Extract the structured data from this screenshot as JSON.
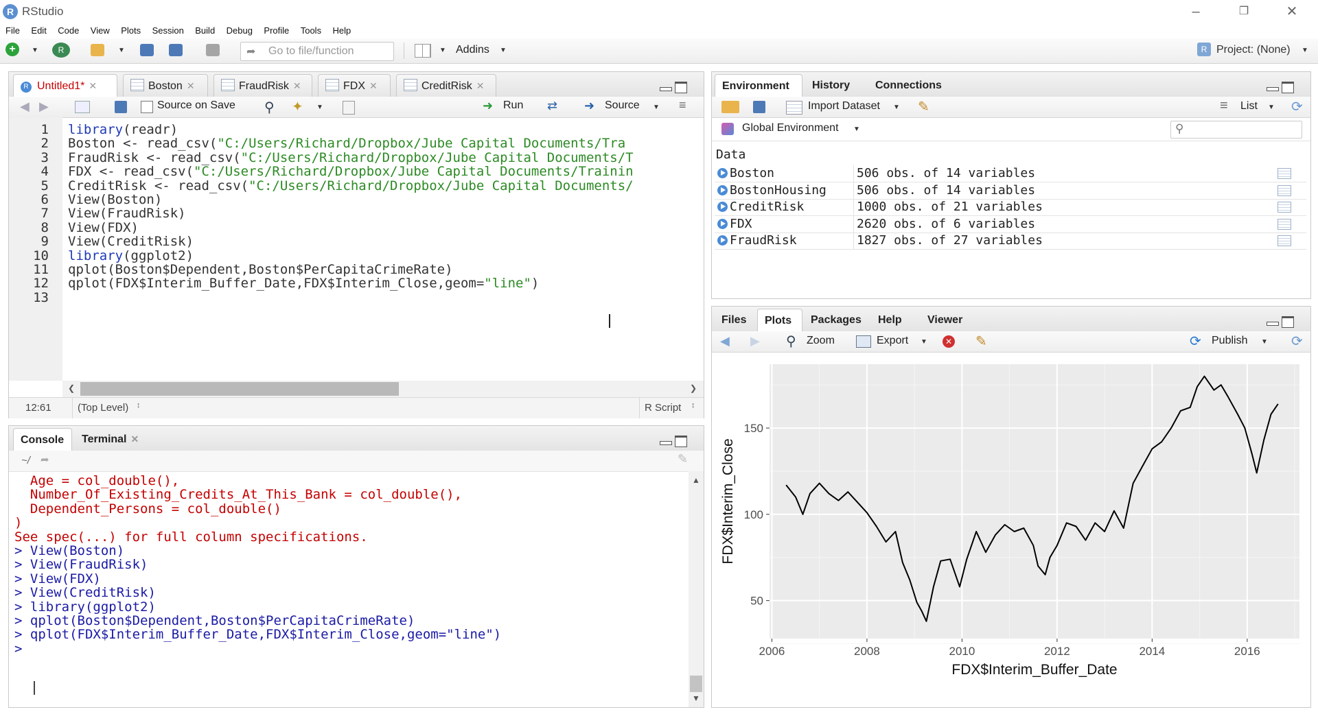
{
  "window": {
    "title": "RStudio",
    "logo": "R"
  },
  "menu": [
    "File",
    "Edit",
    "Code",
    "View",
    "Plots",
    "Session",
    "Build",
    "Debug",
    "Profile",
    "Tools",
    "Help"
  ],
  "toolbar": {
    "goto_placeholder": "Go to file/function",
    "addins": "Addins",
    "project": "Project: (None)"
  },
  "editor": {
    "tabs": [
      "Untitled1*",
      "Boston",
      "FraudRisk",
      "FDX",
      "CreditRisk"
    ],
    "source_on_save": "Source on Save",
    "run": "Run",
    "source": "Source",
    "lines": [
      [
        [
          "kw",
          "library"
        ],
        [
          "op",
          "(readr)"
        ]
      ],
      [
        [
          "op",
          "Boston <- read_csv("
        ],
        [
          "str",
          "\"C:/Users/Richard/Dropbox/Jube Capital Documents/Tra"
        ]
      ],
      [
        [
          "op",
          "FraudRisk <- read_csv("
        ],
        [
          "str",
          "\"C:/Users/Richard/Dropbox/Jube Capital Documents/T"
        ]
      ],
      [
        [
          "op",
          "FDX <- read_csv("
        ],
        [
          "str",
          "\"C:/Users/Richard/Dropbox/Jube Capital Documents/Trainin"
        ]
      ],
      [
        [
          "op",
          "CreditRisk <- read_csv("
        ],
        [
          "str",
          "\"C:/Users/Richard/Dropbox/Jube Capital Documents/"
        ]
      ],
      [
        [
          "op",
          "View(Boston)"
        ]
      ],
      [
        [
          "op",
          "View(FraudRisk)"
        ]
      ],
      [
        [
          "op",
          "View(FDX)"
        ]
      ],
      [
        [
          "op",
          "View(CreditRisk)"
        ]
      ],
      [
        [
          "kw",
          "library"
        ],
        [
          "op",
          "(ggplot2)"
        ]
      ],
      [
        [
          "op",
          "qplot(Boston$Dependent,Boston$PerCapitaCrimeRate)"
        ]
      ],
      [
        [
          "op",
          "qplot(FDX$Interim_Buffer_Date,FDX$Interim_Close,geom="
        ],
        [
          "str",
          "\"line\""
        ],
        [
          "op",
          ")"
        ]
      ],
      []
    ],
    "status_pos": "12:61",
    "status_scope": "(Top Level)",
    "status_type": "R Script"
  },
  "console": {
    "tabs": [
      "Console",
      "Terminal"
    ],
    "path": "~/",
    "lines": [
      [
        "red",
        "  Age = col_double(),"
      ],
      [
        "red",
        "  Number_Of_Existing_Credits_At_This_Bank = col_double(),"
      ],
      [
        "red",
        "  Dependent_Persons = col_double()"
      ],
      [
        "red",
        ")"
      ],
      [
        "red",
        "See spec(...) for full column specifications."
      ],
      [
        "blue",
        "> View(Boston)"
      ],
      [
        "blue",
        "> View(FraudRisk)"
      ],
      [
        "blue",
        "> View(FDX)"
      ],
      [
        "blue",
        "> View(CreditRisk)"
      ],
      [
        "blue",
        "> library(ggplot2)"
      ],
      [
        "blue",
        "> qplot(Boston$Dependent,Boston$PerCapitaCrimeRate)"
      ],
      [
        "blue",
        "> qplot(FDX$Interim_Buffer_Date,FDX$Interim_Close,geom=\"line\")"
      ],
      [
        "blue",
        "> "
      ]
    ]
  },
  "environment": {
    "tabs": [
      "Environment",
      "History",
      "Connections"
    ],
    "import_dataset": "Import Dataset",
    "list": "List",
    "global_env": "Global Environment",
    "section": "Data",
    "rows": [
      {
        "name": "Boston",
        "value": "506 obs. of 14 variables"
      },
      {
        "name": "BostonHousing",
        "value": "506 obs. of 14 variables"
      },
      {
        "name": "CreditRisk",
        "value": "1000 obs. of 21 variables"
      },
      {
        "name": "FDX",
        "value": "2620 obs. of 6 variables"
      },
      {
        "name": "FraudRisk",
        "value": "1827 obs. of 27 variables"
      }
    ]
  },
  "plots_pane": {
    "tabs": [
      "Files",
      "Plots",
      "Packages",
      "Help",
      "Viewer"
    ],
    "zoom": "Zoom",
    "export": "Export",
    "publish": "Publish"
  },
  "chart_data": {
    "type": "line",
    "xlabel": "FDX$Interim_Buffer_Date",
    "ylabel": "FDX$Interim_Close",
    "x_ticks": [
      "2006",
      "2008",
      "2010",
      "2012",
      "2014",
      "2016"
    ],
    "y_ticks": [
      "50",
      "100",
      "150"
    ],
    "xlim": [
      2005.95,
      2017.1
    ],
    "ylim": [
      28,
      187
    ],
    "series": [
      {
        "x": [
          2006.3,
          2006.5,
          2006.65,
          2006.8,
          2007.0,
          2007.2,
          2007.4,
          2007.6,
          2007.8,
          2008.0,
          2008.2,
          2008.4,
          2008.6,
          2008.75,
          2008.9,
          2009.05,
          2009.15,
          2009.25,
          2009.4,
          2009.55,
          2009.75,
          2009.95,
          2010.1,
          2010.3,
          2010.5,
          2010.7,
          2010.9,
          2011.1,
          2011.3,
          2011.5,
          2011.6,
          2011.75,
          2011.85,
          2012.0,
          2012.2,
          2012.4,
          2012.6,
          2012.8,
          2013.0,
          2013.2,
          2013.4,
          2013.6,
          2013.8,
          2014.0,
          2014.2,
          2014.4,
          2014.6,
          2014.8,
          2014.95,
          2015.1,
          2015.3,
          2015.45,
          2015.6,
          2015.8,
          2015.95,
          2016.1,
          2016.2,
          2016.35,
          2016.5,
          2016.65
        ],
        "y": [
          117,
          110,
          100,
          112,
          118,
          112,
          108,
          113,
          107,
          101,
          93,
          84,
          90,
          72,
          62,
          49,
          44,
          38,
          58,
          73,
          74,
          58,
          74,
          90,
          78,
          88,
          94,
          90,
          92,
          82,
          70,
          65,
          75,
          82,
          95,
          93,
          85,
          95,
          90,
          102,
          92,
          118,
          128,
          138,
          142,
          150,
          160,
          162,
          174,
          180,
          172,
          175,
          168,
          158,
          150,
          135,
          124,
          143,
          158,
          164
        ]
      }
    ]
  }
}
